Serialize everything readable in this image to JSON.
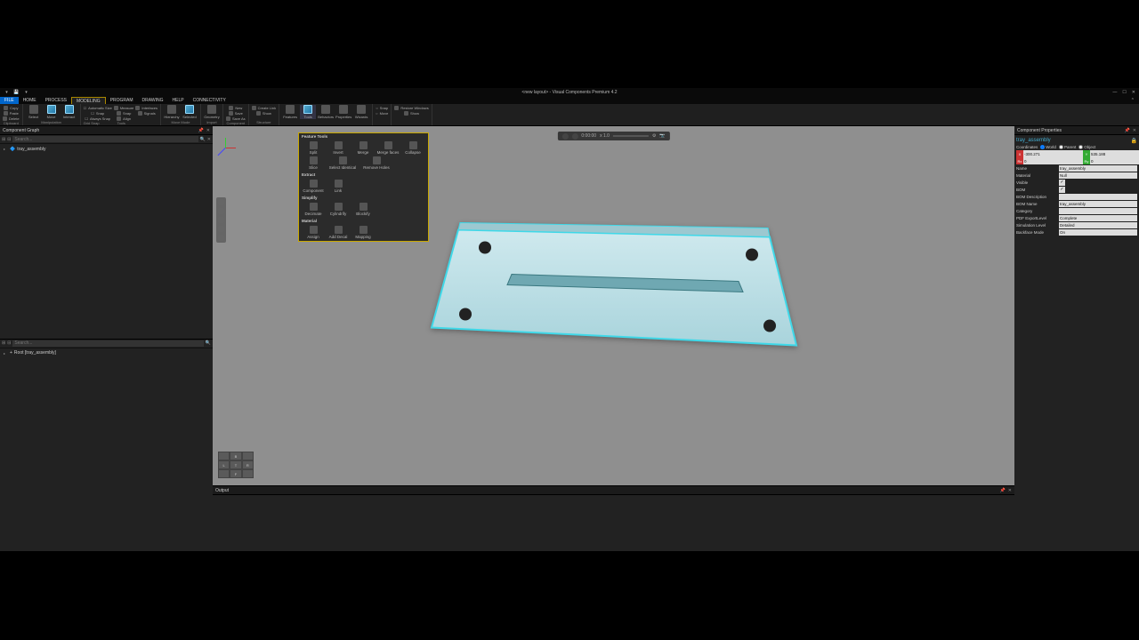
{
  "window": {
    "title": "<new layout> - Visual Components Premium 4.2"
  },
  "tabs": {
    "file": "FILE",
    "home": "HOME",
    "process": "PROCESS",
    "modeling": "MODELING",
    "program": "PROGRAM",
    "drawing": "DRAWING",
    "help": "HELP",
    "connectivity": "CONNECTIVITY"
  },
  "ribbon": {
    "clipboard": {
      "copy": "Copy",
      "paste": "Paste",
      "delete": "Delete",
      "group": "Clipboard"
    },
    "manipulation": {
      "select": "Select",
      "move": "Move",
      "interact": "Interact",
      "group": "Manipulation"
    },
    "gridsnap": {
      "autosize": "Automatic Size",
      "snap": "Snap",
      "always": "Always Snap",
      "measure": "Measure",
      "interfaces": "Interfaces",
      "signals": "Signals",
      "align": "Align",
      "group": "Grid Snap"
    },
    "tools_grp": "Tools",
    "movemode": {
      "hierarchy": "Hierarchy",
      "selected": "Selected",
      "group": "Move Mode"
    },
    "import": {
      "geometry": "Geometry",
      "group": "Import"
    },
    "component": {
      "new": "New",
      "save": "Save",
      "saveas": "Save As",
      "group": "Component"
    },
    "structure": {
      "createlink": "Create Link",
      "show": "Show",
      "group": "Structure"
    },
    "extras": {
      "features": "Features",
      "tools": "Tools",
      "behaviors": "Behaviors",
      "properties": "Properties",
      "wizards": "Wizards"
    },
    "snap2": "Snap",
    "move2": "Move",
    "restore": "Restore Windows",
    "show2": "Show"
  },
  "popup": {
    "header": "Feature Tools",
    "split": "Split",
    "invert": "Invert",
    "merge": "Merge",
    "mergefaces": "Merge faces",
    "collapse": "Collapse",
    "slice": "Slice",
    "selident": "Select Identical",
    "remholes": "Remove Holes",
    "extract_hdr": "Extract",
    "component": "Component",
    "link": "Link",
    "simplify_hdr": "Simplify",
    "decimate": "Decimate",
    "cylindrify": "Cylindrify",
    "blockify": "Blockify",
    "material_hdr": "Material",
    "assign": "Assign",
    "adddecal": "Add Decal",
    "mapping": "Mapping"
  },
  "left": {
    "graph_title": "Component Graph",
    "search_placeholder": "Search...",
    "tree_item": "tray_assembly",
    "feat_item": "Root [tray_assembly]"
  },
  "timebar": {
    "time": "0:00:00",
    "speed": "x 1.0"
  },
  "nav": {
    "t": "T",
    "b": "B",
    "l": "L",
    "r": "R",
    "f": "F"
  },
  "output": {
    "title": "Output"
  },
  "props": {
    "title": "Component Properties",
    "objname": "tray_assembly",
    "coord_label": "Coordinates",
    "world": "World",
    "parent": "Parent",
    "object": "Object",
    "x": "-300.271",
    "y": "535.188",
    "z": "0",
    "rx": "0",
    "ry": "0",
    "rz": "0",
    "fields": {
      "Name": "tray_assembly",
      "Material": "Null",
      "Visible": "check",
      "BOM": "check",
      "BOM Description": "",
      "BOM Name": "tray_assembly",
      "Category": "",
      "PDF ExportLevel": "Complete",
      "Simulation Level": "Detailed",
      "Backface Mode": "On"
    }
  }
}
